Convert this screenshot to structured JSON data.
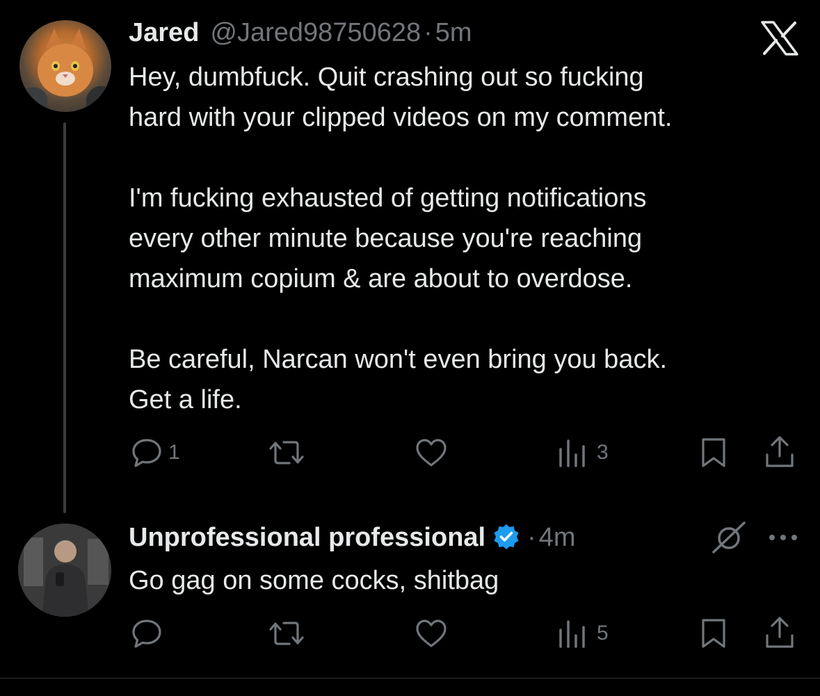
{
  "tweet1": {
    "name": "Jared",
    "handle": "@Jared98750628",
    "separator": "·",
    "time": "5m",
    "lines": [
      "Hey, dumbfuck. Quit crashing out so fucking",
      "hard with your clipped videos on my comment.",
      "",
      "I'm fucking exhausted of getting notifications",
      "every other minute because you're reaching",
      "maximum copium & are about to overdose.",
      "",
      "Be careful, Narcan won't even bring you back.",
      "Get a life."
    ],
    "actions": {
      "replies": "1",
      "reposts": "",
      "likes": "",
      "views": "3"
    }
  },
  "tweet2": {
    "name": "Unprofessional professional",
    "separator": "·",
    "time": "4m",
    "text": "Go gag on some cocks, shitbag",
    "actions": {
      "replies": "",
      "reposts": "",
      "likes": "",
      "views": "5"
    }
  },
  "icons": {
    "logo": "x-logo-icon",
    "verified": "verified-badge-icon",
    "grok": "grok-icon",
    "more": "more-icon",
    "reply": "reply-icon",
    "repost": "repost-icon",
    "like": "like-icon",
    "views": "views-icon",
    "bookmark": "bookmark-icon",
    "share": "share-icon"
  },
  "colors": {
    "background": "#000000",
    "text": "#e7e9ea",
    "secondary": "#71767b",
    "verified": "#1d9bf0"
  }
}
